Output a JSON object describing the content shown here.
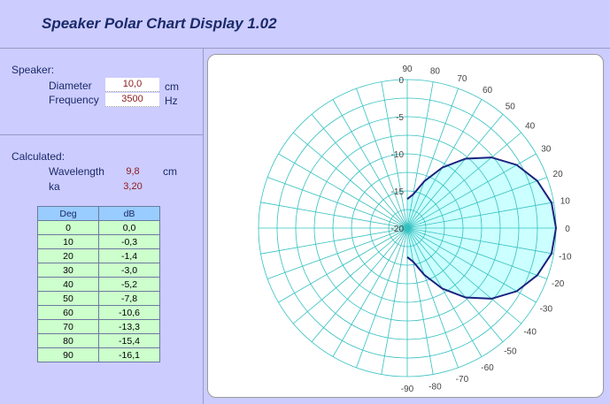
{
  "title": "Speaker Polar Chart Display 1.02",
  "speaker": {
    "section_label": "Speaker:",
    "diameter_label": "Diameter",
    "diameter_value": "10,0",
    "diameter_unit": "cm",
    "frequency_label": "Frequency",
    "frequency_value": "3500",
    "frequency_unit": "Hz"
  },
  "calculated": {
    "section_label": "Calculated:",
    "wavelength_label": "Wavelength",
    "wavelength_value": "9,8",
    "wavelength_unit": "cm",
    "ka_label": "ka",
    "ka_value": "3,20"
  },
  "table": {
    "headers": [
      "Deg",
      "dB"
    ],
    "rows": [
      [
        "0",
        "0,0"
      ],
      [
        "10",
        "-0,3"
      ],
      [
        "20",
        "-1,4"
      ],
      [
        "30",
        "-3,0"
      ],
      [
        "40",
        "-5,2"
      ],
      [
        "50",
        "-7,8"
      ],
      [
        "60",
        "-10,6"
      ],
      [
        "70",
        "-13,3"
      ],
      [
        "80",
        "-15,4"
      ],
      [
        "90",
        "-16,1"
      ]
    ]
  },
  "chart_data": {
    "type": "polar",
    "radial_ticks": [
      0,
      -5,
      -10,
      -15,
      -20
    ],
    "radial_range": [
      -20,
      0
    ],
    "angle_labels": [
      90,
      80,
      70,
      60,
      50,
      40,
      30,
      20,
      10,
      0,
      -10,
      -20,
      -30,
      -40,
      -50,
      -60,
      -70,
      -80,
      -90
    ],
    "angles": [
      0,
      10,
      20,
      30,
      40,
      50,
      60,
      70,
      80,
      90
    ],
    "values": [
      0.0,
      -0.3,
      -1.4,
      -3.0,
      -5.2,
      -7.8,
      -10.6,
      -13.3,
      -15.4,
      -16.1
    ],
    "symmetric": true,
    "colors": {
      "grid": "#33c0c0",
      "line": "#1a237e",
      "fill": "#ccffff"
    }
  }
}
